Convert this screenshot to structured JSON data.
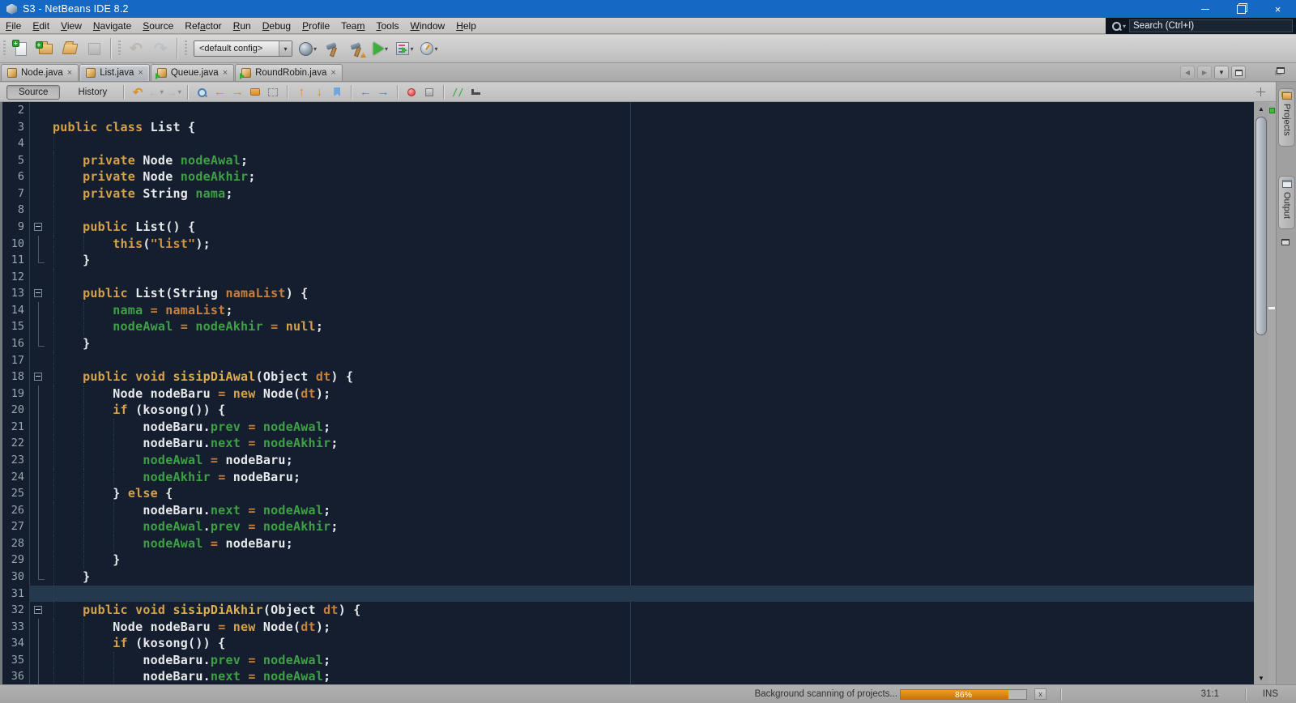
{
  "window": {
    "title": "S3 - NetBeans IDE 8.2"
  },
  "menubar": {
    "items": [
      {
        "label": "File",
        "m": 0
      },
      {
        "label": "Edit",
        "m": 0
      },
      {
        "label": "View",
        "m": 0
      },
      {
        "label": "Navigate",
        "m": 0
      },
      {
        "label": "Source",
        "m": 0
      },
      {
        "label": "Refactor",
        "m": 3
      },
      {
        "label": "Run",
        "m": 0
      },
      {
        "label": "Debug",
        "m": 0
      },
      {
        "label": "Profile",
        "m": 0
      },
      {
        "label": "Team",
        "m": 3
      },
      {
        "label": "Tools",
        "m": 0
      },
      {
        "label": "Window",
        "m": 0
      },
      {
        "label": "Help",
        "m": 0
      }
    ],
    "search_placeholder": "Search (Ctrl+I)"
  },
  "toolbar": {
    "config_value": "<default config>"
  },
  "tab_bar": {
    "tabs": [
      {
        "label": "Node.java",
        "icon": "java-class-icon",
        "active": false
      },
      {
        "label": "List.java",
        "icon": "java-class-icon",
        "active": true
      },
      {
        "label": "Queue.java",
        "icon": "java-class-runnable-icon",
        "active": false
      },
      {
        "label": "RoundRobin.java",
        "icon": "java-class-runnable-icon",
        "active": false
      }
    ]
  },
  "editor_toolbar": {
    "source_label": "Source",
    "history_label": "History",
    "comment_glyph": "//"
  },
  "glyphs": {
    "close": "×",
    "caret_down": "▾",
    "up": "▲",
    "down": "▼",
    "left": "◀",
    "right": "▶",
    "undo": "↶",
    "redo": "↷",
    "arrow_left": "←",
    "arrow_right": "→",
    "arrow_up": "↑",
    "arrow_dn": "↓",
    "cancel": "x"
  },
  "side_dock": {
    "projects_label": "Projects",
    "output_label": "Output"
  },
  "status_bar": {
    "scan_text": "Background scanning of projects...",
    "progress_percent": 86,
    "progress_label": "86%",
    "caret_position": "31:1",
    "insert_mode": "INS"
  },
  "code": {
    "lines": [
      {
        "n": 2,
        "t": [],
        "g": [],
        "fold": ""
      },
      {
        "n": 3,
        "t": [
          [
            "k",
            "public"
          ],
          [
            "p",
            " "
          ],
          [
            "k",
            "class"
          ],
          [
            "p",
            " List {"
          ]
        ],
        "g": [],
        "fold": ""
      },
      {
        "n": 4,
        "t": [],
        "g": [
          0
        ],
        "fold": ""
      },
      {
        "n": 5,
        "t": [
          [
            "p",
            "    "
          ],
          [
            "k",
            "private"
          ],
          [
            "p",
            " Node "
          ],
          [
            "f",
            "nodeAwal"
          ],
          [
            "p",
            ";"
          ]
        ],
        "g": [
          0
        ],
        "fold": ""
      },
      {
        "n": 6,
        "t": [
          [
            "p",
            "    "
          ],
          [
            "k",
            "private"
          ],
          [
            "p",
            " Node "
          ],
          [
            "f",
            "nodeAkhir"
          ],
          [
            "p",
            ";"
          ]
        ],
        "g": [
          0
        ],
        "fold": ""
      },
      {
        "n": 7,
        "t": [
          [
            "p",
            "    "
          ],
          [
            "k",
            "private"
          ],
          [
            "p",
            " String "
          ],
          [
            "f",
            "nama"
          ],
          [
            "p",
            ";"
          ]
        ],
        "g": [
          0
        ],
        "fold": ""
      },
      {
        "n": 8,
        "t": [],
        "g": [
          0
        ],
        "fold": ""
      },
      {
        "n": 9,
        "t": [
          [
            "p",
            "    "
          ],
          [
            "k",
            "public"
          ],
          [
            "p",
            " List() {"
          ]
        ],
        "g": [
          0
        ],
        "fold": "box"
      },
      {
        "n": 10,
        "t": [
          [
            "p",
            "        "
          ],
          [
            "k",
            "this"
          ],
          [
            "p",
            "("
          ],
          [
            "s",
            "\"list\""
          ],
          [
            "p",
            ");"
          ]
        ],
        "g": [
          0,
          4
        ],
        "fold": "line"
      },
      {
        "n": 11,
        "t": [
          [
            "p",
            "    }"
          ]
        ],
        "g": [
          0
        ],
        "fold": "end"
      },
      {
        "n": 12,
        "t": [],
        "g": [
          0
        ],
        "fold": ""
      },
      {
        "n": 13,
        "t": [
          [
            "p",
            "    "
          ],
          [
            "k",
            "public"
          ],
          [
            "p",
            " List(String "
          ],
          [
            "m",
            "namaList"
          ],
          [
            "p",
            ") {"
          ]
        ],
        "g": [
          0
        ],
        "fold": "box"
      },
      {
        "n": 14,
        "t": [
          [
            "p",
            "        "
          ],
          [
            "f",
            "nama"
          ],
          [
            "p",
            " "
          ],
          [
            "o",
            "="
          ],
          [
            "p",
            " "
          ],
          [
            "m",
            "namaList"
          ],
          [
            "p",
            ";"
          ]
        ],
        "g": [
          0,
          4
        ],
        "fold": "line"
      },
      {
        "n": 15,
        "t": [
          [
            "p",
            "        "
          ],
          [
            "f",
            "nodeAwal"
          ],
          [
            "p",
            " "
          ],
          [
            "o",
            "="
          ],
          [
            "p",
            " "
          ],
          [
            "f",
            "nodeAkhir"
          ],
          [
            "p",
            " "
          ],
          [
            "o",
            "="
          ],
          [
            "p",
            " "
          ],
          [
            "k",
            "null"
          ],
          [
            "p",
            ";"
          ]
        ],
        "g": [
          0,
          4
        ],
        "fold": "line"
      },
      {
        "n": 16,
        "t": [
          [
            "p",
            "    }"
          ]
        ],
        "g": [
          0
        ],
        "fold": "end"
      },
      {
        "n": 17,
        "t": [],
        "g": [
          0
        ],
        "fold": ""
      },
      {
        "n": 18,
        "t": [
          [
            "p",
            "    "
          ],
          [
            "k",
            "public"
          ],
          [
            "p",
            " "
          ],
          [
            "k",
            "void"
          ],
          [
            "p",
            " "
          ],
          [
            "fn",
            "sisipDiAwal"
          ],
          [
            "p",
            "(Object "
          ],
          [
            "m",
            "dt"
          ],
          [
            "p",
            ") {"
          ]
        ],
        "g": [
          0
        ],
        "fold": "box"
      },
      {
        "n": 19,
        "t": [
          [
            "p",
            "        Node nodeBaru "
          ],
          [
            "o",
            "="
          ],
          [
            "p",
            " "
          ],
          [
            "k",
            "new"
          ],
          [
            "p",
            " Node("
          ],
          [
            "m",
            "dt"
          ],
          [
            "p",
            ");"
          ]
        ],
        "g": [
          0,
          4
        ],
        "fold": "line"
      },
      {
        "n": 20,
        "t": [
          [
            "p",
            "        "
          ],
          [
            "k",
            "if"
          ],
          [
            "p",
            " (kosong()) {"
          ]
        ],
        "g": [
          0,
          4
        ],
        "fold": "line"
      },
      {
        "n": 21,
        "t": [
          [
            "p",
            "            nodeBaru."
          ],
          [
            "f",
            "prev"
          ],
          [
            "p",
            " "
          ],
          [
            "o",
            "="
          ],
          [
            "p",
            " "
          ],
          [
            "f",
            "nodeAwal"
          ],
          [
            "p",
            ";"
          ]
        ],
        "g": [
          0,
          4,
          8
        ],
        "fold": "line"
      },
      {
        "n": 22,
        "t": [
          [
            "p",
            "            nodeBaru."
          ],
          [
            "f",
            "next"
          ],
          [
            "p",
            " "
          ],
          [
            "o",
            "="
          ],
          [
            "p",
            " "
          ],
          [
            "f",
            "nodeAkhir"
          ],
          [
            "p",
            ";"
          ]
        ],
        "g": [
          0,
          4,
          8
        ],
        "fold": "line"
      },
      {
        "n": 23,
        "t": [
          [
            "p",
            "            "
          ],
          [
            "f",
            "nodeAwal"
          ],
          [
            "p",
            " "
          ],
          [
            "o",
            "="
          ],
          [
            "p",
            " nodeBaru;"
          ]
        ],
        "g": [
          0,
          4,
          8
        ],
        "fold": "line"
      },
      {
        "n": 24,
        "t": [
          [
            "p",
            "            "
          ],
          [
            "f",
            "nodeAkhir"
          ],
          [
            "p",
            " "
          ],
          [
            "o",
            "="
          ],
          [
            "p",
            " nodeBaru;"
          ]
        ],
        "g": [
          0,
          4,
          8
        ],
        "fold": "line"
      },
      {
        "n": 25,
        "t": [
          [
            "p",
            "        } "
          ],
          [
            "k",
            "else"
          ],
          [
            "p",
            " {"
          ]
        ],
        "g": [
          0,
          4
        ],
        "fold": "line"
      },
      {
        "n": 26,
        "t": [
          [
            "p",
            "            nodeBaru."
          ],
          [
            "f",
            "next"
          ],
          [
            "p",
            " "
          ],
          [
            "o",
            "="
          ],
          [
            "p",
            " "
          ],
          [
            "f",
            "nodeAwal"
          ],
          [
            "p",
            ";"
          ]
        ],
        "g": [
          0,
          4,
          8
        ],
        "fold": "line"
      },
      {
        "n": 27,
        "t": [
          [
            "p",
            "            "
          ],
          [
            "f",
            "nodeAwal"
          ],
          [
            "p",
            "."
          ],
          [
            "f",
            "prev"
          ],
          [
            "p",
            " "
          ],
          [
            "o",
            "="
          ],
          [
            "p",
            " "
          ],
          [
            "f",
            "nodeAkhir"
          ],
          [
            "p",
            ";"
          ]
        ],
        "g": [
          0,
          4,
          8
        ],
        "fold": "line"
      },
      {
        "n": 28,
        "t": [
          [
            "p",
            "            "
          ],
          [
            "f",
            "nodeAwal"
          ],
          [
            "p",
            " "
          ],
          [
            "o",
            "="
          ],
          [
            "p",
            " nodeBaru;"
          ]
        ],
        "g": [
          0,
          4,
          8
        ],
        "fold": "line"
      },
      {
        "n": 29,
        "t": [
          [
            "p",
            "        }"
          ]
        ],
        "g": [
          0,
          4
        ],
        "fold": "line"
      },
      {
        "n": 30,
        "t": [
          [
            "p",
            "    }"
          ]
        ],
        "g": [
          0
        ],
        "fold": "end"
      },
      {
        "n": 31,
        "t": [],
        "g": [
          0
        ],
        "fold": "",
        "cur": true
      },
      {
        "n": 32,
        "t": [
          [
            "p",
            "    "
          ],
          [
            "k",
            "public"
          ],
          [
            "p",
            " "
          ],
          [
            "k",
            "void"
          ],
          [
            "p",
            " "
          ],
          [
            "fn",
            "sisipDiAkhir"
          ],
          [
            "p",
            "(Object "
          ],
          [
            "m",
            "dt"
          ],
          [
            "p",
            ") {"
          ]
        ],
        "g": [
          0
        ],
        "fold": "box"
      },
      {
        "n": 33,
        "t": [
          [
            "p",
            "        Node nodeBaru "
          ],
          [
            "o",
            "="
          ],
          [
            "p",
            " "
          ],
          [
            "k",
            "new"
          ],
          [
            "p",
            " Node("
          ],
          [
            "m",
            "dt"
          ],
          [
            "p",
            ");"
          ]
        ],
        "g": [
          0,
          4
        ],
        "fold": "line"
      },
      {
        "n": 34,
        "t": [
          [
            "p",
            "        "
          ],
          [
            "k",
            "if"
          ],
          [
            "p",
            " (kosong()) {"
          ]
        ],
        "g": [
          0,
          4
        ],
        "fold": "line"
      },
      {
        "n": 35,
        "t": [
          [
            "p",
            "            nodeBaru."
          ],
          [
            "f",
            "prev"
          ],
          [
            "p",
            " "
          ],
          [
            "o",
            "="
          ],
          [
            "p",
            " "
          ],
          [
            "f",
            "nodeAwal"
          ],
          [
            "p",
            ";"
          ]
        ],
        "g": [
          0,
          4,
          8
        ],
        "fold": "line"
      },
      {
        "n": 36,
        "t": [
          [
            "p",
            "            nodeBaru."
          ],
          [
            "f",
            "next"
          ],
          [
            "p",
            " "
          ],
          [
            "o",
            "="
          ],
          [
            "p",
            " "
          ],
          [
            "f",
            "nodeAwal"
          ],
          [
            "p",
            ";"
          ]
        ],
        "g": [
          0,
          4,
          8
        ],
        "fold": "line"
      }
    ]
  }
}
